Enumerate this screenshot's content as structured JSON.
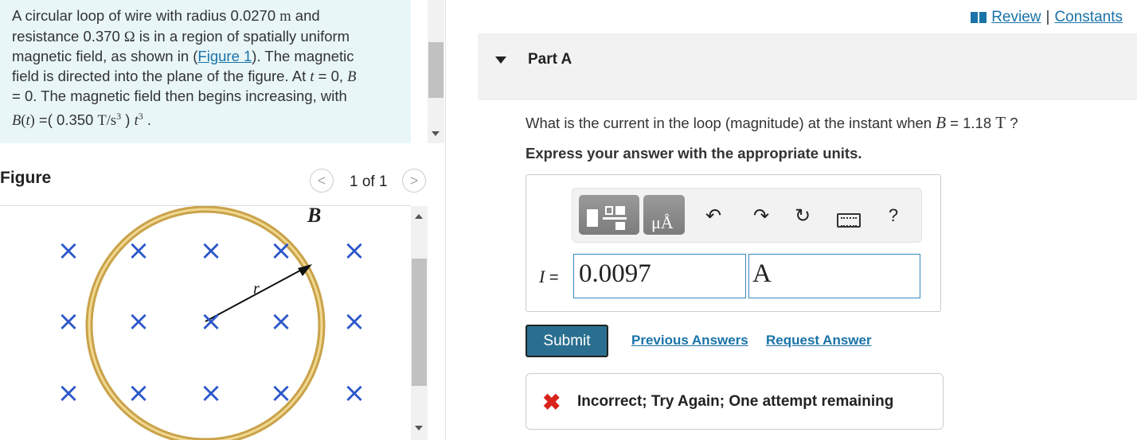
{
  "problem": {
    "line1_pre": "A circular loop of wire with radius 0.0270 ",
    "line1_unit": "m",
    "line1_post": " and",
    "line2_pre": "resistance 0.370 ",
    "line2_unit": "Ω",
    "line2_post": " is in a region of spatially uniform",
    "line3": "magnetic field, as shown in (",
    "figure_link": "Figure 1",
    "line3_post": "). The magnetic",
    "line4_pre": "field is directed into the plane of the figure. At ",
    "t_sym": "t",
    "line4_mid": " = 0, ",
    "B_sym": "B",
    "line5": "= 0. The magnetic field then begins increasing, with",
    "formula_B": "B",
    "formula_t": "t",
    "formula_open": "(",
    "formula_close": ")",
    "formula_eq": " =( 0.350 ",
    "formula_unit": "T/s",
    "formula_unit_exp": "3",
    "formula_tail": " ) ",
    "formula_t2": "t",
    "formula_t2_exp": "3",
    "formula_end": " ."
  },
  "figure": {
    "title": "Figure",
    "counter": "1 of 1",
    "prev_glyph": "<",
    "next_glyph": ">",
    "b_label": "B",
    "r_label": "r",
    "cross_glyph": "×"
  },
  "header_links": {
    "review": "Review",
    "separator": "|",
    "constants": "Constants"
  },
  "part": {
    "title": "Part A",
    "question_pre": "What is the current in the loop (magnitude) at the instant when ",
    "question_B": "B",
    "question_mid": " = 1.18 ",
    "question_unit": "T",
    "question_post": " ?",
    "instruction": "Express your answer with the appropriate units."
  },
  "toolbar": {
    "undo_glyph": "↶",
    "redo_glyph": "↷",
    "reset_glyph": "↻",
    "help_glyph": "?",
    "units_glyph": "μÅ"
  },
  "answer": {
    "label_var": "I",
    "label_eq": " =",
    "value": "0.0097",
    "unit": "A"
  },
  "actions": {
    "submit": "Submit",
    "previous_answers": "Previous Answers",
    "request_answer": "Request Answer"
  },
  "feedback": {
    "icon": "✖",
    "text": "Incorrect; Try Again; One attempt remaining"
  },
  "colors": {
    "link": "#1a73a8",
    "submit_bg": "#2a6f8f",
    "error": "#d9221c",
    "problem_bg": "#e8f6f8",
    "ring": "#c9a24a"
  }
}
